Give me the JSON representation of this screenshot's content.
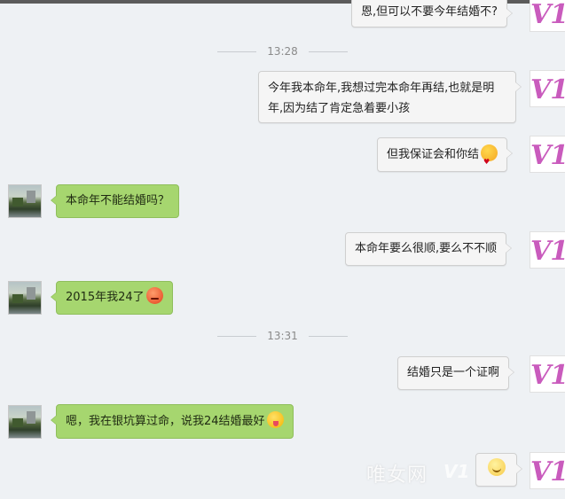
{
  "messages": [
    {
      "text": "恩,但可以不要今年结婚不?"
    },
    {
      "text": "今年我本命年,我想过完本命年再结,也就是明年,因为结了肯定急着要小孩"
    },
    {
      "text": "但我保证会和你结",
      "emoji": "kiss-emoji"
    },
    {
      "text": "本命年不能结婚吗？"
    },
    {
      "text": "本命年要么很顺,要么不不顺"
    },
    {
      "text": "2015年我24了",
      "emoji": "angry-emoji"
    },
    {
      "text": "结婚只是一个证啊"
    },
    {
      "text": "嗯，我在银坑算过命，说我24结婚最好",
      "emoji": "tongue-emoji"
    },
    {
      "text": "",
      "emoji": "smile-emoji"
    }
  ],
  "timestamps": [
    "13:28",
    "13:31"
  ],
  "avatar_me_text": "V1",
  "watermark": {
    "main": "唯女网",
    "sub": "V1"
  }
}
